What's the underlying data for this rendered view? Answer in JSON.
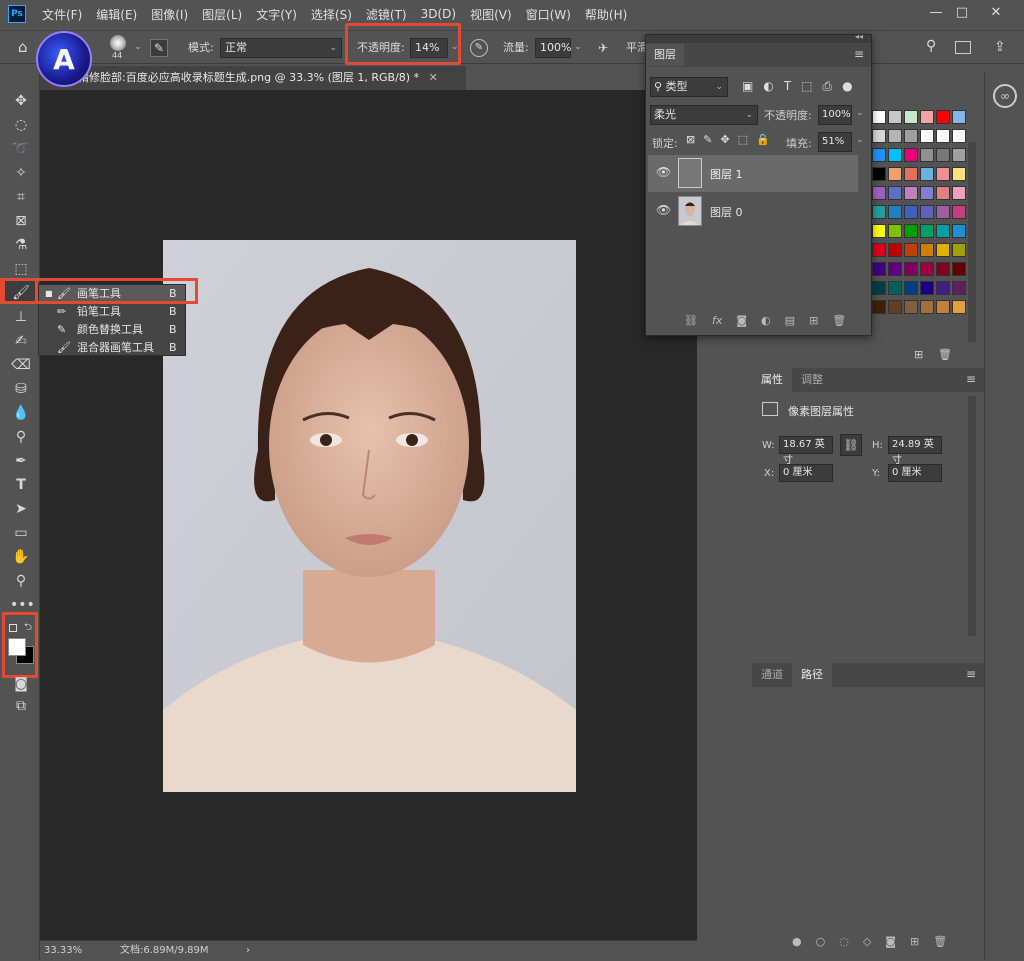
{
  "menu": {
    "app_icon": "Ps",
    "items": [
      "文件(F)",
      "编辑(E)",
      "图像(I)",
      "图层(L)",
      "文字(Y)",
      "选择(S)",
      "滤镜(T)",
      "3D(D)",
      "视图(V)",
      "窗口(W)",
      "帮助(H)"
    ]
  },
  "options": {
    "brush_size": "44",
    "mode_label": "模式:",
    "mode_value": "正常",
    "opacity_label": "不透明度:",
    "opacity_value": "14%",
    "flow_label": "流量:",
    "flow_value": "100%",
    "smooth_label": "平滑"
  },
  "document": {
    "tab_title": "精修脸部:百度必应高收录标题生成.png @ 33.3% (图层 1, RGB/8) *",
    "zoom": "33.33%",
    "doc_info": "文档:6.89M/9.89M"
  },
  "flyout": {
    "items": [
      {
        "label": "画笔工具",
        "key": "B"
      },
      {
        "label": "铅笔工具",
        "key": "B"
      },
      {
        "label": "颜色替换工具",
        "key": "B"
      },
      {
        "label": "混合器画笔工具",
        "key": "B"
      }
    ]
  },
  "layers": {
    "tab": "图层",
    "filter_kind": "类型",
    "blend_mode": "柔光",
    "opacity_label": "不透明度:",
    "opacity_value": "100%",
    "lock_label": "锁定:",
    "fill_label": "填充:",
    "fill_value": "51%",
    "rows": [
      {
        "name": "图层 1"
      },
      {
        "name": "图层 0"
      }
    ]
  },
  "properties": {
    "tab_active": "属性",
    "tab_other": "调整",
    "title": "像素图层属性",
    "w_label": "W:",
    "w_value": "18.67 英寸",
    "h_label": "H:",
    "h_value": "24.89 英寸",
    "x_label": "X:",
    "x_value": "0 厘米",
    "y_label": "Y:",
    "y_value": "0 厘米"
  },
  "paths": {
    "tab_other": "通道",
    "tab_active": "路径"
  },
  "colors": {
    "accent_red": "#e24a33",
    "ps_blue": "#31a8ff"
  },
  "swatches": [
    "#ffffff",
    "#c8c8c8",
    "#c8e6c8",
    "#f4a3a3",
    "#ff0000",
    "#88b4e8",
    "#d6d6d6",
    "#b4b4b4",
    "#a0a0a0",
    "#ffffff",
    "#ffffff",
    "#ffffff",
    "#1e90ff",
    "#00c0ff",
    "#e6007e",
    "#909090",
    "#787878",
    "#a0a0a0",
    "#000000",
    "#f0a070",
    "#e07060",
    "#70b0e0",
    "#f09090",
    "#ffe080",
    "#a060c0",
    "#6070c0",
    "#c080c0",
    "#8080d0",
    "#e08080",
    "#f0a0c0",
    "#20a0a0",
    "#2080c0",
    "#4060c0",
    "#6060c0",
    "#a060a0",
    "#c04080",
    "#ffff00",
    "#80c000",
    "#00a000",
    "#00a060",
    "#00a0a0",
    "#2090d0",
    "#e00020",
    "#c00000",
    "#c04000",
    "#d08000",
    "#e0b000",
    "#a0a000",
    "#400080",
    "#600080",
    "#800060",
    "#a00040",
    "#800020",
    "#600000",
    "#004040",
    "#006060",
    "#004080",
    "#200080",
    "#402080",
    "#602060",
    "#402000",
    "#604020",
    "#806040",
    "#a07040",
    "#c08040",
    "#e0a040"
  ]
}
